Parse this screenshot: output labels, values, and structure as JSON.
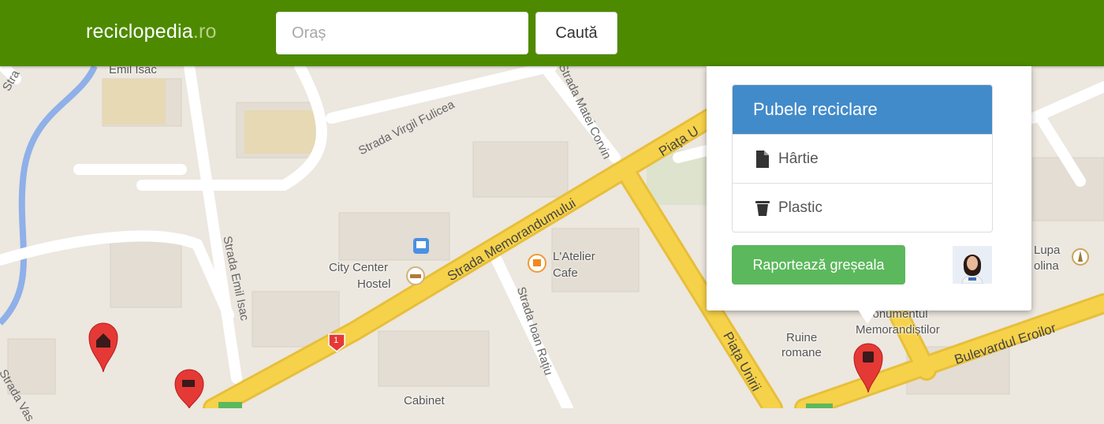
{
  "header": {
    "brand_name": "reciclopedia",
    "brand_tld": ".ro",
    "city_placeholder": "Oraș",
    "city_value": "",
    "search_button": "Caută"
  },
  "popup": {
    "title": "Pubele reciclare",
    "items": [
      {
        "label": "Hârtie",
        "icon": "document-icon"
      },
      {
        "label": "Plastic",
        "icon": "bin-icon"
      }
    ],
    "report_button": "Raportează greșeala"
  },
  "map": {
    "streets": [
      "Strada Memorandumului",
      "Strada Virgil Fulicea",
      "Strada Matei Corvin",
      "Strada Emil Isac",
      "Strada Ioan Rațiu",
      "Piața Unirii",
      "Piața U",
      "Bulevardul Eroilor",
      "Strada Vas",
      "Emil Isac",
      "Stra"
    ],
    "places": [
      "City Center",
      "Hostel",
      "L'Atelier",
      "Cafe",
      "Ruine",
      "romane",
      "Monumentul",
      "Memorandiștilor",
      "Lupa",
      "olina",
      "Cabinet"
    ],
    "route_shield": "1",
    "colors": {
      "header": "#4e8a00",
      "primary": "#428bca",
      "success": "#5cb85c",
      "marker": "#e53935",
      "road_major": "#f6d24a"
    }
  }
}
